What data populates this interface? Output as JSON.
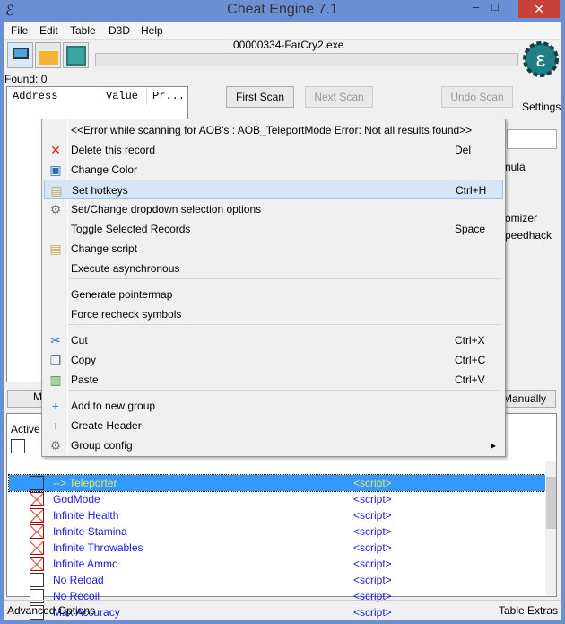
{
  "window": {
    "title": "Cheat Engine 7.1",
    "close": "✕",
    "minmax": "–□"
  },
  "menu": [
    "File",
    "Edit",
    "Table",
    "D3D",
    "Help"
  ],
  "process": "00000334-FarCry2.exe",
  "found": "Found: 0",
  "address_list": {
    "columns": [
      "Address",
      "Value",
      "Pr..."
    ]
  },
  "buttons": {
    "first_scan": "First Scan",
    "next_scan": "Next Scan",
    "undo_scan": "Undo Scan",
    "settings": "Settings",
    "add_manually": "Manually",
    "lower_left": "M"
  },
  "right_partial": [
    "nula",
    "omizer",
    "peedhack"
  ],
  "context_menu": {
    "error": "<<Error while scanning for AOB's : AOB_TeleportMode  Error: Not all results found>>",
    "items": [
      {
        "label": "Delete this record",
        "shortcut": "Del",
        "icon": "✕"
      },
      {
        "label": "Change Color",
        "shortcut": "",
        "icon": "▣"
      },
      {
        "label": "Set hotkeys",
        "shortcut": "Ctrl+H",
        "icon": "▤"
      },
      {
        "label": "Set/Change dropdown selection options",
        "shortcut": "",
        "icon": "⚙"
      },
      {
        "label": "Toggle Selected Records",
        "shortcut": "Space",
        "icon": ""
      },
      {
        "label": "Change script",
        "shortcut": "",
        "icon": "▤"
      },
      {
        "label": "Execute asynchronous",
        "shortcut": "",
        "icon": ""
      },
      {
        "label": "Generate pointermap",
        "shortcut": "",
        "icon": ""
      },
      {
        "label": "Force recheck symbols",
        "shortcut": "",
        "icon": ""
      },
      {
        "label": "Cut",
        "shortcut": "Ctrl+X",
        "icon": "✂"
      },
      {
        "label": "Copy",
        "shortcut": "Ctrl+C",
        "icon": "❐"
      },
      {
        "label": "Paste",
        "shortcut": "Ctrl+V",
        "icon": "▥"
      },
      {
        "label": "Add to new group",
        "shortcut": "",
        "icon": "+"
      },
      {
        "label": "Create Header",
        "shortcut": "",
        "icon": "+"
      },
      {
        "label": "Group config",
        "shortcut": "▸",
        "icon": "⚙"
      }
    ]
  },
  "cheat_table": {
    "active_header": "Active",
    "rows": [
      {
        "desc": "--> Teleporter",
        "value": "<script>",
        "active": false,
        "selected": true
      },
      {
        "desc": "GodMode",
        "value": "<script>",
        "active": true
      },
      {
        "desc": "Infinite Health",
        "value": "<script>",
        "active": true
      },
      {
        "desc": "Infinite Stamina",
        "value": "<script>",
        "active": true
      },
      {
        "desc": "Infinite Throwables",
        "value": "<script>",
        "active": true
      },
      {
        "desc": "Infinite Ammo",
        "value": "<script>",
        "active": true
      },
      {
        "desc": "No Reload",
        "value": "<script>",
        "active": false
      },
      {
        "desc": "No Recoil",
        "value": "<script>",
        "active": false
      },
      {
        "desc": "Max Accuracy",
        "value": "<script>",
        "active": false
      }
    ]
  },
  "status": {
    "left": "Advanced Options",
    "right": "Table Extras"
  },
  "colors": {
    "titlebar": "#6a8fd2",
    "selection": "#3399ff",
    "script_text": "#1a1adf"
  }
}
